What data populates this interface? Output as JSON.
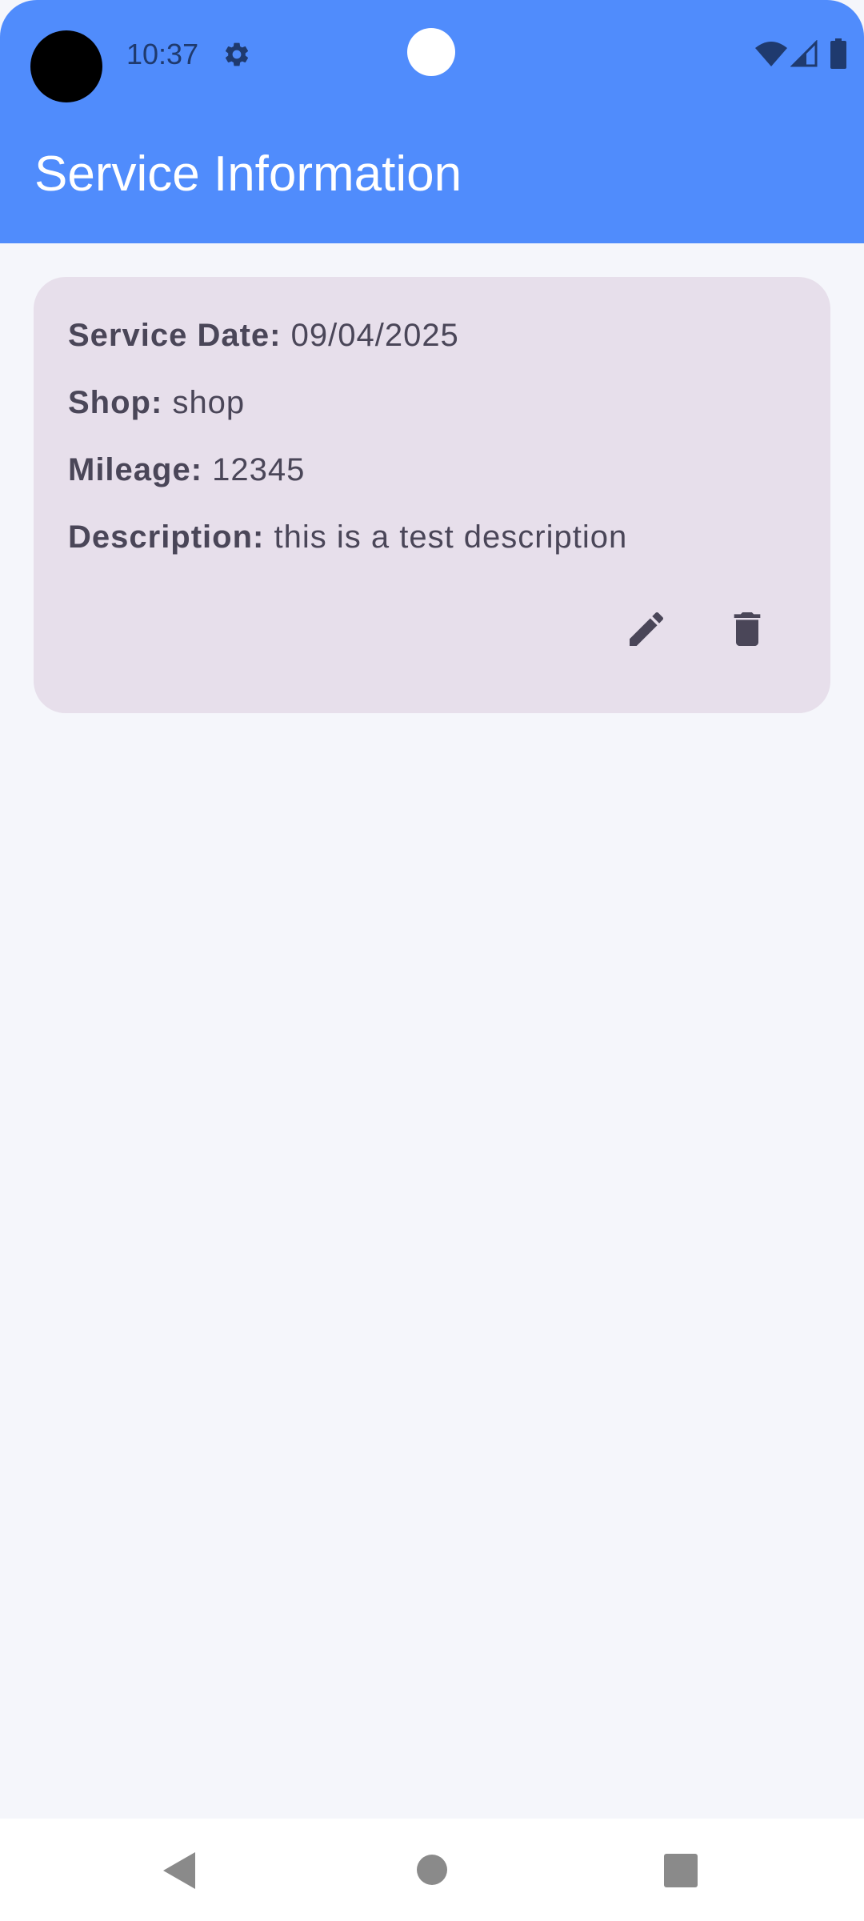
{
  "status_bar": {
    "time": "10:37",
    "icons": [
      "gear-icon",
      "wifi-icon",
      "signal-icon",
      "battery-icon"
    ]
  },
  "app_bar": {
    "title": "Service Information",
    "color": "#508cfc"
  },
  "service_card": {
    "background": "#e7dfeb",
    "fields": [
      {
        "label": "Service Date:",
        "value": "09/04/2025"
      },
      {
        "label": "Shop:",
        "value": "shop"
      },
      {
        "label": "Mileage:",
        "value": "12345"
      },
      {
        "label": "Description:",
        "value": "this is a test description"
      }
    ],
    "actions": [
      "edit-icon",
      "delete-icon"
    ]
  },
  "nav_bar": {
    "buttons": [
      "back-icon",
      "home-icon",
      "recents-icon"
    ]
  }
}
